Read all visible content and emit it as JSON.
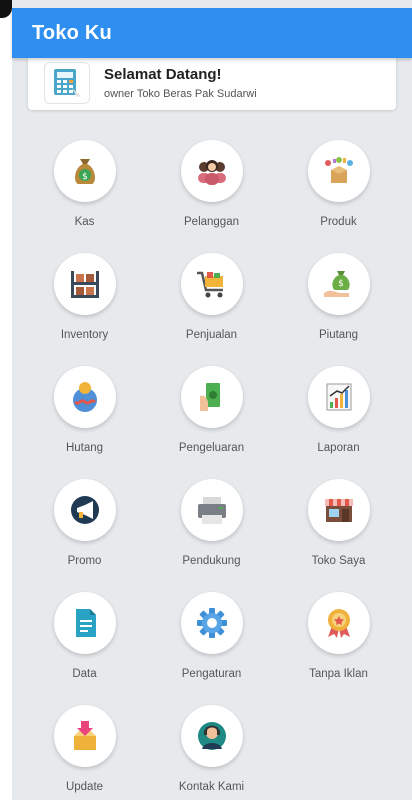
{
  "appbar": {
    "title": "Toko Ku"
  },
  "welcome": {
    "title": "Selamat Datang!",
    "subtitle": "owner Toko Beras Pak Sudarwi",
    "icon": "calculator-icon"
  },
  "menu": [
    {
      "label": "Kas",
      "icon": "money-bag-icon"
    },
    {
      "label": "Pelanggan",
      "icon": "customers-icon"
    },
    {
      "label": "Produk",
      "icon": "product-box-icon"
    },
    {
      "label": "Inventory",
      "icon": "shelf-icon"
    },
    {
      "label": "Penjualan",
      "icon": "shopping-cart-icon"
    },
    {
      "label": "Piutang",
      "icon": "hand-money-icon"
    },
    {
      "label": "Hutang",
      "icon": "coin-piggy-icon"
    },
    {
      "label": "Pengeluaran",
      "icon": "cash-hand-icon"
    },
    {
      "label": "Laporan",
      "icon": "report-chart-icon"
    },
    {
      "label": "Promo",
      "icon": "megaphone-icon"
    },
    {
      "label": "Pendukung",
      "icon": "printer-icon"
    },
    {
      "label": "Toko Saya",
      "icon": "store-icon"
    },
    {
      "label": "Data",
      "icon": "document-icon"
    },
    {
      "label": "Pengaturan",
      "icon": "gear-icon"
    },
    {
      "label": "Tanpa Iklan",
      "icon": "award-badge-icon"
    },
    {
      "label": "Update",
      "icon": "download-box-icon"
    },
    {
      "label": "Kontak Kami",
      "icon": "support-agent-icon"
    }
  ],
  "colors": {
    "appbar": "#2f8ff0",
    "background": "#e7eaed"
  }
}
